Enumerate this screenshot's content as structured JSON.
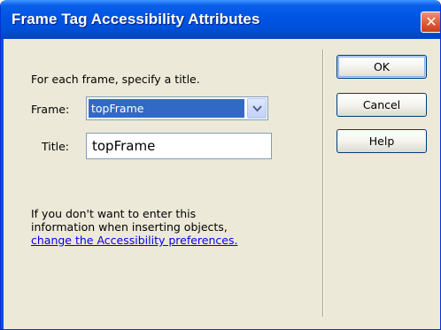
{
  "window": {
    "title": "Frame Tag Accessibility Attributes",
    "close_glyph": "✕"
  },
  "form": {
    "instruction": "For each frame, specify a title.",
    "frame_label": "Frame:",
    "frame_selected": "topFrame",
    "title_label": "Title:",
    "title_value": "topFrame"
  },
  "note": {
    "text_line1": "If you don't want to enter this",
    "text_line2": "information when inserting objects,",
    "link": "change the Accessibility preferences."
  },
  "buttons": {
    "ok": "OK",
    "cancel": "Cancel",
    "help": "Help"
  },
  "colors": {
    "titlebar": "#0054e3",
    "dialog_bg": "#ece9d8",
    "selection": "#316ac5",
    "link": "#0000ee",
    "close_button": "#e25a34"
  }
}
